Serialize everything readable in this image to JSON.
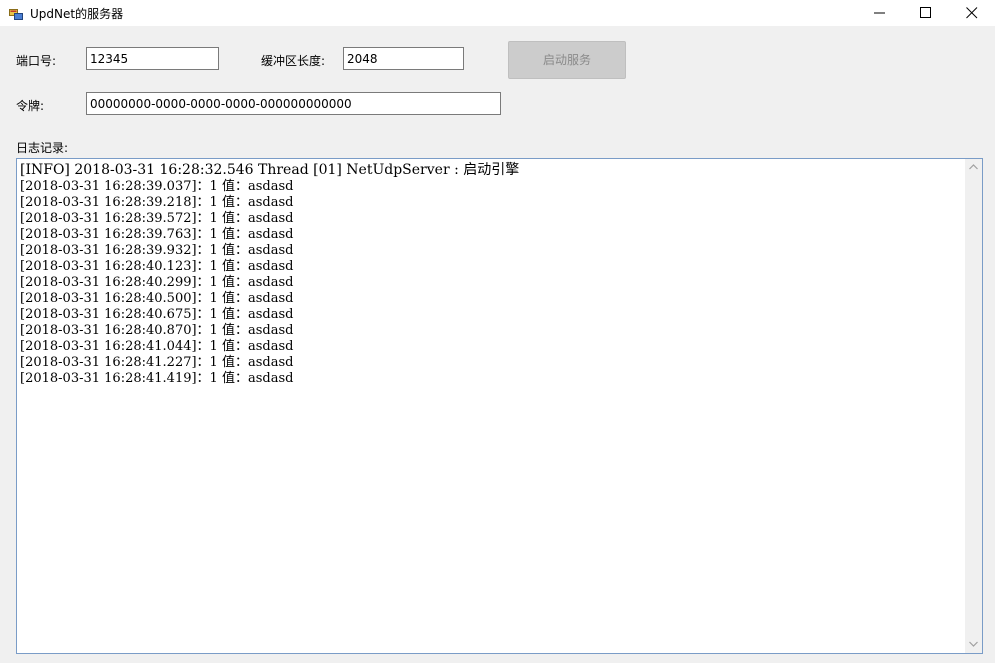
{
  "window": {
    "title": "UpdNet的服务器"
  },
  "form": {
    "port_label": "端口号:",
    "port_value": "12345",
    "buffer_label": "缓冲区长度:",
    "buffer_value": "2048",
    "start_button": "启动服务",
    "token_label": "令牌:",
    "token_value": "00000000-0000-0000-0000-000000000000",
    "log_label": "日志记录:"
  },
  "log": {
    "lines": [
      "[INFO] 2018-03-31 16:28:32.546 Thread [01] NetUdpServer : 启动引擎",
      "[2018-03-31 16:28:39.037]：1 值：asdasd",
      "[2018-03-31 16:28:39.218]：1 值：asdasd",
      "[2018-03-31 16:28:39.572]：1 值：asdasd",
      "[2018-03-31 16:28:39.763]：1 值：asdasd",
      "[2018-03-31 16:28:39.932]：1 值：asdasd",
      "[2018-03-31 16:28:40.123]：1 值：asdasd",
      "[2018-03-31 16:28:40.299]：1 值：asdasd",
      "[2018-03-31 16:28:40.500]：1 值：asdasd",
      "[2018-03-31 16:28:40.675]：1 值：asdasd",
      "[2018-03-31 16:28:40.870]：1 值：asdasd",
      "[2018-03-31 16:28:41.044]：1 值：asdasd",
      "[2018-03-31 16:28:41.227]：1 值：asdasd",
      "[2018-03-31 16:28:41.419]：1 值：asdasd"
    ]
  },
  "icons": {
    "app": "app-window-icon",
    "minimize": "minimize-icon",
    "maximize": "maximize-icon",
    "close": "close-icon",
    "scroll_up": "chevron-up-icon",
    "scroll_down": "chevron-down-icon"
  },
  "colors": {
    "log_border": "#7a9cc7",
    "disabled_button": "#cccccc"
  }
}
